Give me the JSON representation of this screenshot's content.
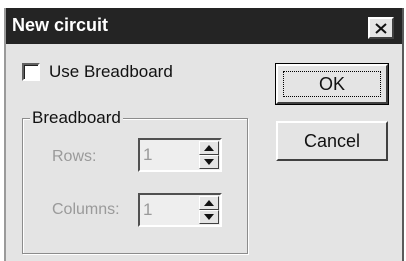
{
  "dialog": {
    "title": "New circuit",
    "use_breadboard": {
      "label": "Use Breadboard",
      "checked": false
    },
    "group": {
      "legend": "Breadboard",
      "rows": {
        "label": "Rows:",
        "value": "1"
      },
      "columns": {
        "label": "Columns:",
        "value": "1"
      }
    },
    "buttons": {
      "ok": "OK",
      "cancel": "Cancel"
    },
    "icons": {
      "close": "close-icon",
      "spin_up": "spin-up-arrow-icon",
      "spin_down": "spin-down-arrow-icon"
    }
  },
  "colors": {
    "title_bar": "#242424",
    "dialog_background": "#e4e4e4",
    "disabled_text": "#9a9a9a"
  }
}
